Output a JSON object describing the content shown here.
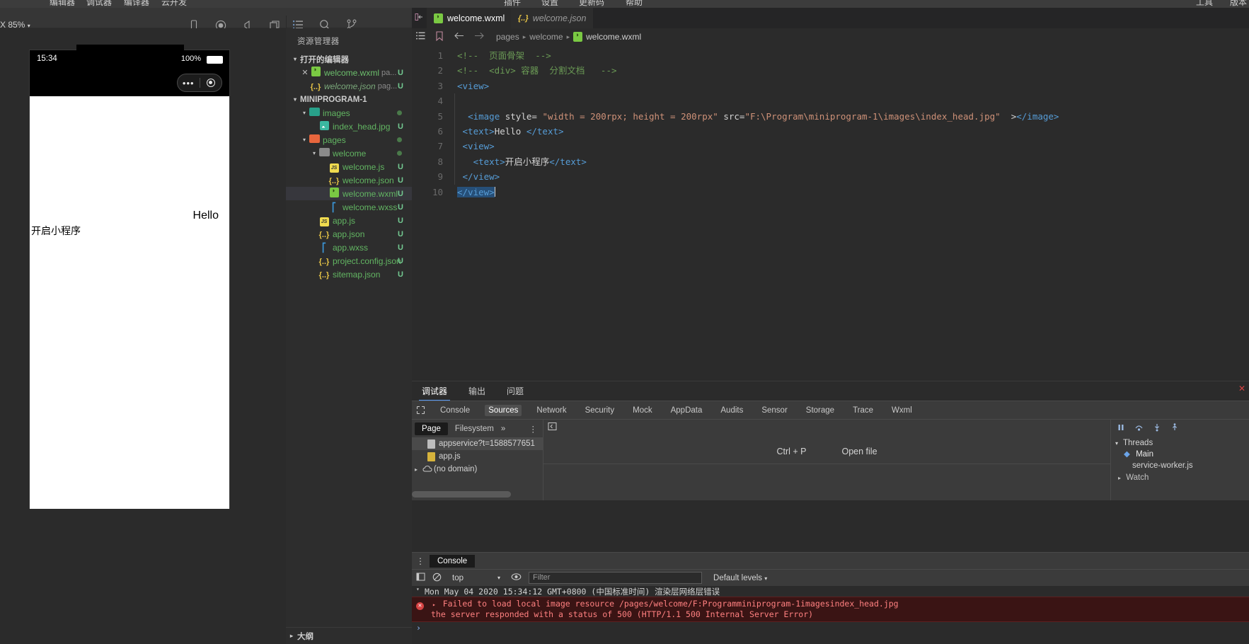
{
  "menubar": {
    "left_items": [
      "编辑器",
      "调试器",
      "编译器",
      "云开发"
    ],
    "right_items": [
      "插件",
      "设置",
      "更新码",
      "帮助"
    ],
    "far_right": [
      "工具",
      "版本"
    ]
  },
  "toolbar": {
    "zoom_label": "X 85%",
    "zoom_caret": "▾",
    "sim_icons": [
      "phone-icon",
      "record-icon",
      "speaker-icon",
      "window-icon"
    ],
    "explorer_icons": [
      "files-icon",
      "search-icon",
      "source-control-icon"
    ],
    "right_labels": [
      "输出",
      "设置"
    ]
  },
  "simulator": {
    "status_time": "15:34",
    "battery_pct": "100%",
    "capsule_dots": "•••",
    "page": {
      "hello_text": "Hello",
      "sub_text": "开启小程序"
    }
  },
  "explorer": {
    "title": "资源管理器",
    "open_editors": {
      "label": "打开的编辑器",
      "twisty": "▾",
      "items": [
        {
          "name": "welcome.wxml",
          "suffix": "pa...",
          "status": "U",
          "icon": "wxml-icon",
          "close": "✕",
          "selected": false,
          "italic": false
        },
        {
          "name": "welcome.json",
          "suffix": "pag...",
          "status": "U",
          "icon": "json-icon",
          "close": "",
          "selected": false,
          "italic": true
        }
      ]
    },
    "project": {
      "label": "MINIPROGRAM-1",
      "twisty": "▾",
      "tree": [
        {
          "depth": 1,
          "twisty": "▾",
          "name": "images",
          "icon": "folder-images-icon",
          "status": "dot",
          "selected": false
        },
        {
          "depth": 2,
          "twisty": "",
          "name": "index_head.jpg",
          "icon": "image-file-icon",
          "status": "U",
          "selected": false
        },
        {
          "depth": 1,
          "twisty": "▾",
          "name": "pages",
          "icon": "folder-pages-icon",
          "status": "dot",
          "selected": false
        },
        {
          "depth": 2,
          "twisty": "▾",
          "name": "welcome",
          "icon": "folder-icon",
          "status": "dot",
          "selected": false
        },
        {
          "depth": 3,
          "twisty": "",
          "name": "welcome.js",
          "icon": "js-icon",
          "status": "U",
          "selected": false
        },
        {
          "depth": 3,
          "twisty": "",
          "name": "welcome.json",
          "icon": "json-icon",
          "status": "U",
          "selected": false
        },
        {
          "depth": 3,
          "twisty": "",
          "name": "welcome.wxml",
          "icon": "wxml-icon",
          "status": "U",
          "selected": true
        },
        {
          "depth": 3,
          "twisty": "",
          "name": "welcome.wxss",
          "icon": "wxss-icon",
          "status": "U",
          "selected": false
        },
        {
          "depth": 2,
          "twisty": "",
          "name": "app.js",
          "icon": "js-icon",
          "status": "U",
          "selected": false
        },
        {
          "depth": 2,
          "twisty": "",
          "name": "app.json",
          "icon": "json-icon",
          "status": "U",
          "selected": false
        },
        {
          "depth": 2,
          "twisty": "",
          "name": "app.wxss",
          "icon": "wxss-icon",
          "status": "U",
          "selected": false
        },
        {
          "depth": 2,
          "twisty": "",
          "name": "project.config.json",
          "icon": "json-icon",
          "status": "U",
          "selected": false
        },
        {
          "depth": 2,
          "twisty": "",
          "name": "sitemap.json",
          "icon": "json-icon",
          "status": "U",
          "selected": false
        }
      ]
    },
    "outline_label": "大纲",
    "outline_twisty": "▸"
  },
  "editor": {
    "tabs": [
      {
        "label": "welcome.wxml",
        "icon": "wxml-icon",
        "active": true,
        "close": "✕"
      },
      {
        "label": "welcome.json",
        "icon": "json-icon",
        "active": false,
        "close": ""
      }
    ],
    "breadcrumb": {
      "icons": [
        "list-icon",
        "bookmark-icon",
        "arrow-left-icon",
        "arrow-right-icon"
      ],
      "parts": [
        "pages",
        "welcome",
        "welcome.wxml"
      ],
      "separator": "▸"
    },
    "lines": [
      {
        "no": "1",
        "segments": [
          {
            "cls": "cmt",
            "t": "<!--  页面骨架  -->"
          }
        ]
      },
      {
        "no": "2",
        "segments": [
          {
            "cls": "cmt",
            "t": "<!--  <div> 容器  分割文档   -->"
          }
        ]
      },
      {
        "no": "3",
        "segments": [
          {
            "cls": "tag",
            "t": "<view>"
          }
        ]
      },
      {
        "no": "4",
        "segments": []
      },
      {
        "no": "5",
        "segments": [
          {
            "cls": "sp",
            "t": "  "
          },
          {
            "cls": "tag",
            "t": "<image"
          },
          {
            "cls": "txt",
            "t": " style= "
          },
          {
            "cls": "str",
            "t": "\"width = 200rpx; height = 200rpx\""
          },
          {
            "cls": "txt",
            "t": " src="
          },
          {
            "cls": "str",
            "t": "\"F:\\Program\\miniprogram-1\\images\\index_head.jpg\""
          },
          {
            "cls": "txt",
            "t": "  >"
          },
          {
            "cls": "tag",
            "t": "</image>"
          }
        ]
      },
      {
        "no": "6",
        "segments": [
          {
            "cls": "sp",
            "t": " "
          },
          {
            "cls": "tag",
            "t": "<text>"
          },
          {
            "cls": "txt",
            "t": "Hello "
          },
          {
            "cls": "tag",
            "t": "</text>"
          }
        ]
      },
      {
        "no": "7",
        "segments": [
          {
            "cls": "sp",
            "t": " "
          },
          {
            "cls": "tag",
            "t": "<view>"
          }
        ]
      },
      {
        "no": "8",
        "segments": [
          {
            "cls": "sp",
            "t": "   "
          },
          {
            "cls": "tag",
            "t": "<text>"
          },
          {
            "cls": "txt",
            "t": "开启小程序"
          },
          {
            "cls": "tag",
            "t": "</text>"
          }
        ]
      },
      {
        "no": "9",
        "segments": [
          {
            "cls": "sp",
            "t": " "
          },
          {
            "cls": "tag",
            "t": "</view>"
          }
        ]
      },
      {
        "no": "10",
        "segments": [
          {
            "cls": "selt",
            "t": "</view>"
          }
        ]
      }
    ]
  },
  "devtools": {
    "top_tabs": [
      {
        "label": "调试器",
        "active": true
      },
      {
        "label": "输出",
        "active": false
      },
      {
        "label": "问题",
        "active": false
      }
    ],
    "panels": [
      {
        "label": "Console",
        "active": false
      },
      {
        "label": "Sources",
        "active": true
      },
      {
        "label": "Network",
        "active": false
      },
      {
        "label": "Security",
        "active": false
      },
      {
        "label": "Mock",
        "active": false
      },
      {
        "label": "AppData",
        "active": false
      },
      {
        "label": "Audits",
        "active": false
      },
      {
        "label": "Sensor",
        "active": false
      },
      {
        "label": "Storage",
        "active": false
      },
      {
        "label": "Trace",
        "active": false
      },
      {
        "label": "Wxml",
        "active": false
      }
    ],
    "inspect_icon": "inspect-icon",
    "close_icon": "✕",
    "sources": {
      "subtabs": [
        {
          "label": "Page",
          "active": true
        },
        {
          "label": "Filesystem",
          "active": false
        },
        {
          "label": "»",
          "active": false
        }
      ],
      "kebab": "⋮",
      "tree": [
        {
          "label": "appservice?t=1588577651",
          "icon": "doc-icon",
          "arrow": "",
          "selected": true
        },
        {
          "label": "app.js",
          "icon": "js-file-icon",
          "arrow": "",
          "selected": false
        },
        {
          "label": "(no domain)",
          "icon": "cloud-icon",
          "arrow": "▸",
          "selected": false
        }
      ],
      "hint_shortcut": "Ctrl + P",
      "hint_action": "Open file",
      "panel_toggle_icon": "show-navigator-icon"
    },
    "debugger_side": {
      "controls": [
        "pause-icon",
        "step-over-icon",
        "step-into-icon",
        "step-out-icon"
      ],
      "threads_label": "Threads",
      "threads_twisty": "▾",
      "threads": [
        {
          "label": "Main",
          "bullet": "◆",
          "active": true
        },
        {
          "label": "service-worker.js",
          "bullet": "",
          "active": false
        }
      ],
      "watch_label": "Watch",
      "watch_twisty": "▸"
    },
    "console": {
      "tab_label": "Console",
      "kebab": "⋮",
      "context": "top",
      "context_caret": "▾",
      "eye_icon": "eye-icon",
      "filter_placeholder": "Filter",
      "levels_label": "Default levels",
      "levels_caret": "▾",
      "group_arrow": "▾",
      "group_line": "Mon May 04 2020 15:34:12 GMT+0800 (中国标准时间) 渲染层网络层错误",
      "error": {
        "badge": "✕",
        "arrow": "▸",
        "line1": "Failed to load local image resource /pages/welcome/F:Programminiprogram-1imagesindex_head.jpg",
        "line2": "the server responded with a status of 500 (HTTP/1.1 500 Internal Server Error)"
      },
      "prompt": "›"
    }
  }
}
